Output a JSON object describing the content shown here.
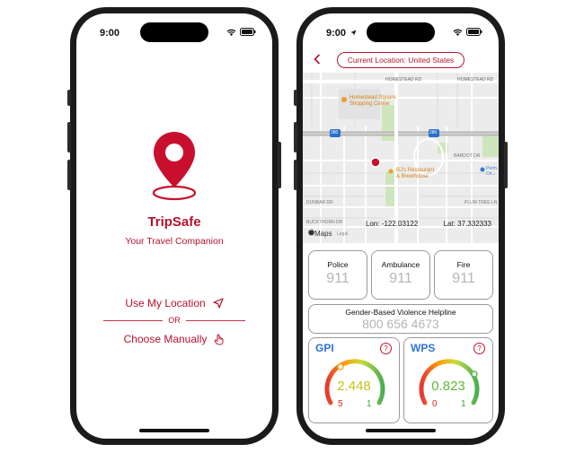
{
  "status_bar": {
    "time": "9:00"
  },
  "left_screen": {
    "app_name": "TripSafe",
    "tagline": "Your Travel Companion",
    "use_location_label": "Use My Location",
    "or_label": "OR",
    "choose_manually_label": "Choose Manually"
  },
  "right_screen": {
    "current_location": "Current Location: United States",
    "map": {
      "labels": {
        "street_top_left": "HOMESTEAD RD",
        "street_top_right": "HOMESTEAD RD",
        "poi_1": "Homestead Square Shopping Center",
        "poi_2": "BJ's Restaurant & Brewhouse",
        "highway": "280",
        "street_left": "DUNBAR DR",
        "street_left2": "BUCKTHORN DR",
        "street_right": "PLUM TREE LN",
        "street_mid": "BARDOT DR",
        "poi_3": "Perm... Ch..."
      },
      "maps_brand": "Maps",
      "legal": "Legal",
      "lon": "Lon: -122.03122",
      "lat": "Lat: 37.332333"
    },
    "emergency": [
      {
        "label": "Police",
        "number": "911"
      },
      {
        "label": "Ambulance",
        "number": "911"
      },
      {
        "label": "Fire",
        "number": "911"
      }
    ],
    "helpline": {
      "label": "Gender-Based Violence Helpline",
      "number": "800 656 4673"
    },
    "gauges": [
      {
        "name": "GPI",
        "value": "2.448",
        "min": "5",
        "max": "1",
        "value_color": "#c7c21a"
      },
      {
        "name": "WPS",
        "value": "0.823",
        "min": "0",
        "max": "1",
        "value_color": "#64b83a"
      }
    ]
  },
  "colors": {
    "brand": "#b5132d",
    "blue_label": "#2f73d9"
  }
}
